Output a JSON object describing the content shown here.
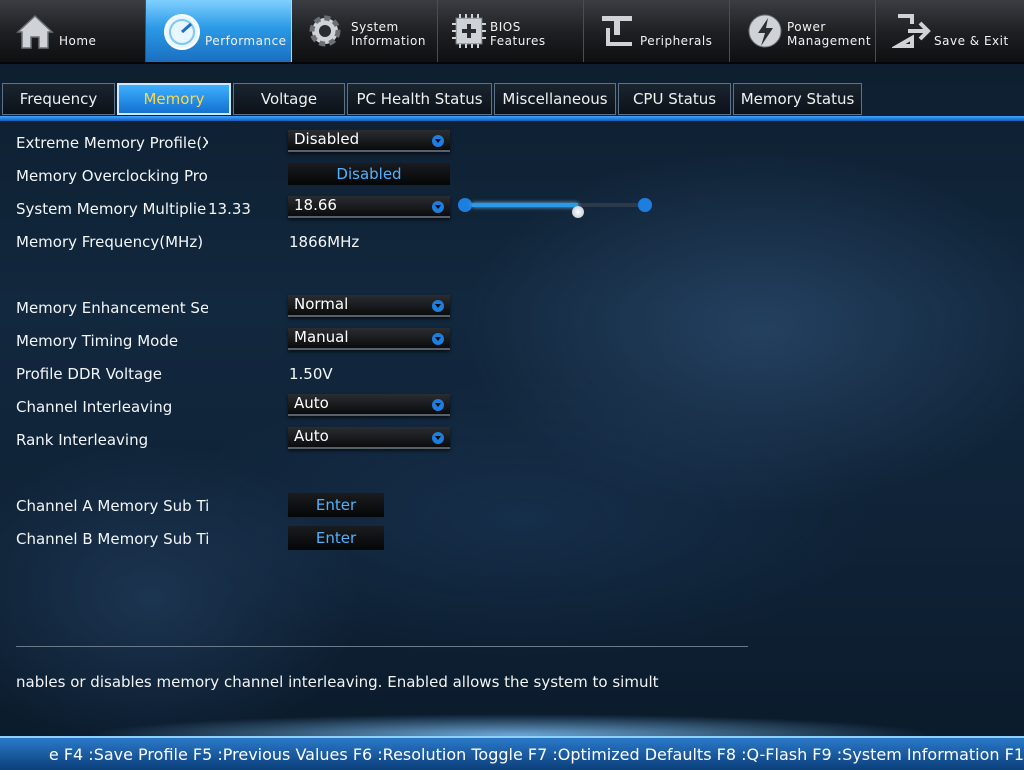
{
  "topnav": [
    {
      "label": "Home",
      "icon": "home-icon"
    },
    {
      "label": "Performance",
      "icon": "speedometer-icon",
      "active": true
    },
    {
      "label": "System\nInformation",
      "icon": "gear-icon"
    },
    {
      "label": "BIOS\nFeatures",
      "icon": "bios-chip-icon"
    },
    {
      "label": "Peripherals",
      "icon": "peripherals-icon"
    },
    {
      "label": "Power\nManagement",
      "icon": "power-icon"
    },
    {
      "label": "Save & Exit",
      "icon": "exit-icon"
    }
  ],
  "subtabs": [
    {
      "label": "Frequency"
    },
    {
      "label": "Memory",
      "active": true
    },
    {
      "label": "Voltage"
    },
    {
      "label": "PC Health Status"
    },
    {
      "label": "Miscellaneous"
    },
    {
      "label": "CPU Status"
    },
    {
      "label": "Memory Status"
    }
  ],
  "settings": {
    "xmp": {
      "label": "Extreme Memory Profile(X",
      "value": "Disabled"
    },
    "overclock_profile": {
      "label": "Memory Overclocking Pro",
      "value": "Disabled"
    },
    "multiplier": {
      "label": "System Memory Multiplie",
      "extra": "13.33",
      "value": "18.66",
      "slider_fraction": 0.64
    },
    "frequency": {
      "label": "Memory Frequency(MHz)",
      "value": "1866MHz"
    },
    "enhancement": {
      "label": "Memory Enhancement Se",
      "value": "Normal"
    },
    "timing_mode": {
      "label": "Memory Timing Mode",
      "value": "Manual"
    },
    "ddr_voltage": {
      "label": "Profile DDR Voltage",
      "value": "1.50V"
    },
    "channel_interleaving": {
      "label": "Channel Interleaving",
      "value": "Auto"
    },
    "rank_interleaving": {
      "label": "Rank Interleaving",
      "value": "Auto"
    },
    "channel_a": {
      "label": "Channel A Memory Sub Ti",
      "value": "Enter"
    },
    "channel_b": {
      "label": "Channel B Memory Sub Ti",
      "value": "Enter"
    }
  },
  "help_text": "nables or disables memory channel interleaving. Enabled allows the system to simult",
  "hotkeys": "e F4 :Save Profile F5 :Previous Values F6 :Resolution Toggle F7 :Optimized Defaults F8 :Q-Flash F9 :System Information F1",
  "colors": {
    "accent": "#2b9ae6",
    "active_tab_text": "#ffd84a",
    "button_text": "#4fb3ff"
  }
}
